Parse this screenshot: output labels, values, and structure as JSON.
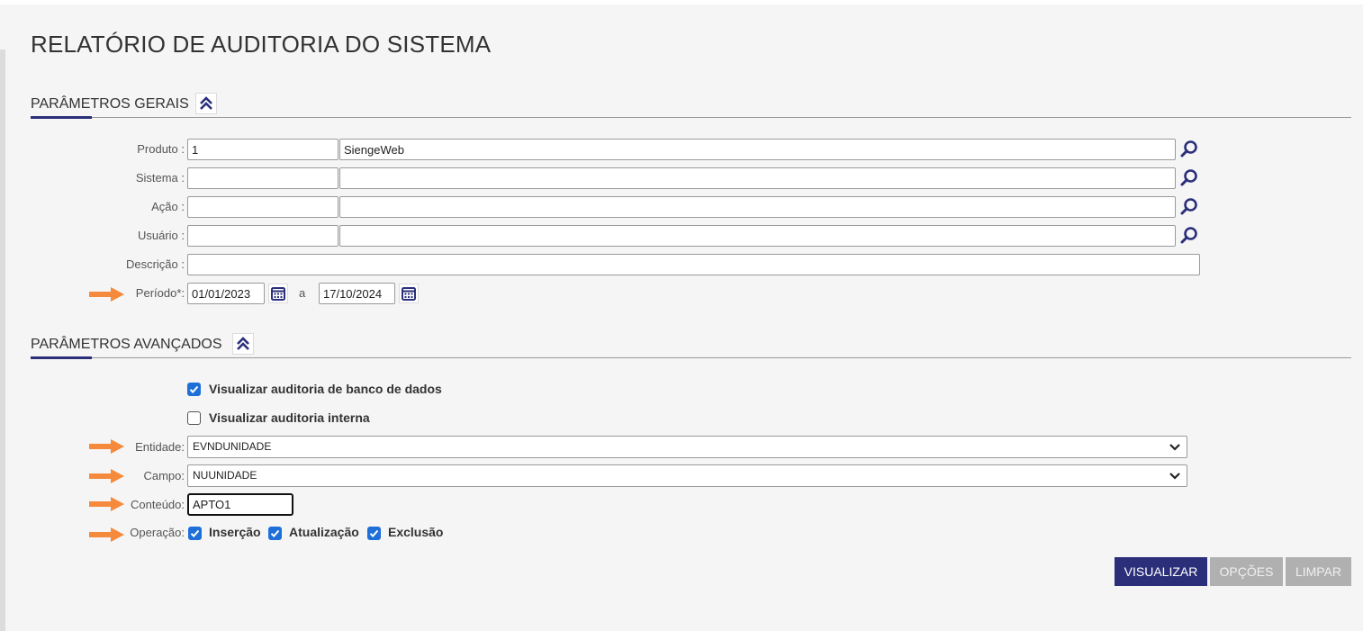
{
  "page": {
    "title": "RELATÓRIO DE AUDITORIA DO SISTEMA"
  },
  "general": {
    "title": "PARÂMETROS GERAIS",
    "produto": {
      "label": "Produto :",
      "code": "1",
      "name": "SiengeWeb"
    },
    "sistema": {
      "label": "Sistema :",
      "code": "",
      "name": ""
    },
    "acao": {
      "label": "Ação :",
      "code": "",
      "name": ""
    },
    "usuario": {
      "label": "Usuário :",
      "code": "",
      "name": ""
    },
    "descricao": {
      "label": "Descrição :",
      "value": ""
    },
    "periodo": {
      "label": "Período*:",
      "start": "01/01/2023",
      "separator": "a",
      "end": "17/10/2024"
    }
  },
  "advanced": {
    "title": "PARÂMETROS AVANÇADOS",
    "db_audit": {
      "label": "Visualizar auditoria de banco de dados",
      "checked": true
    },
    "internal_audit": {
      "label": "Visualizar auditoria interna",
      "checked": false
    },
    "entidade": {
      "label": "Entidade:",
      "value": "EVNDUNIDADE"
    },
    "campo": {
      "label": "Campo:",
      "value": "NUUNIDADE"
    },
    "conteudo": {
      "label": "Conteúdo:",
      "value": "APTO1"
    },
    "operacao": {
      "label": "Operação:",
      "options": [
        {
          "label": "Inserção",
          "checked": true
        },
        {
          "label": "Atualização",
          "checked": true
        },
        {
          "label": "Exclusão",
          "checked": true
        }
      ]
    }
  },
  "actions": {
    "visualizar": "VISUALIZAR",
    "opcoes": "OPÇÕES",
    "limpar": "LIMPAR"
  },
  "colors": {
    "primary": "#2b2f7a",
    "accent_arrow": "#f58a3c",
    "checkbox": "#1f6fd9",
    "disabled": "#b0b0b0"
  }
}
